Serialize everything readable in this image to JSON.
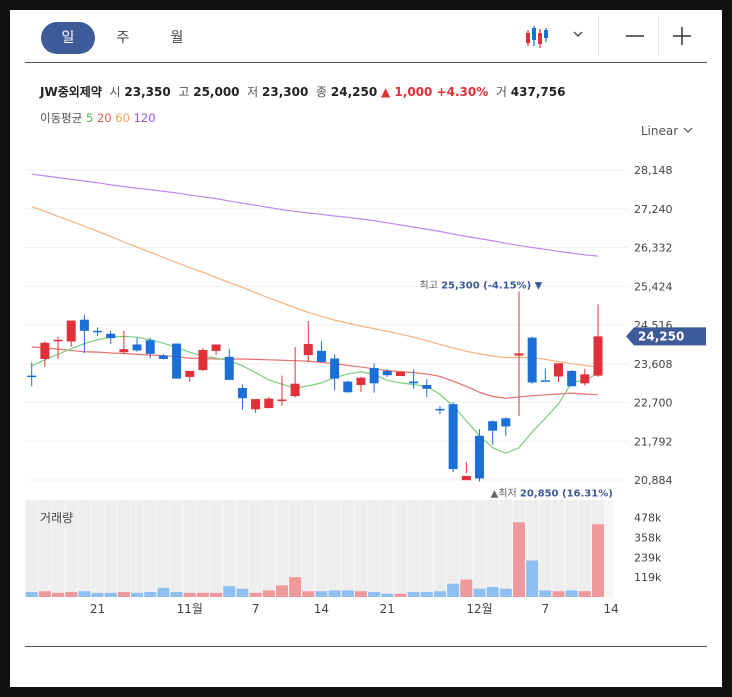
{
  "tabs": [
    {
      "label": "일",
      "active": true
    },
    {
      "label": "주",
      "active": false
    },
    {
      "label": "월",
      "active": false
    }
  ],
  "stock": {
    "name": "JW중외제약",
    "open_label": "시",
    "open": "23,350",
    "high_label": "고",
    "high": "25,000",
    "low_label": "저",
    "low": "23,300",
    "close_label": "종",
    "close": "24,250",
    "change": "▲ 1,000 +4.30%",
    "volume_label": "거",
    "volume": "437,756"
  },
  "moving_average": {
    "label": "이동평균",
    "periods": [
      {
        "value": "5",
        "color": "#4db04d"
      },
      {
        "value": "20",
        "color": "#e05a4f"
      },
      {
        "value": "60",
        "color": "#f0a05a"
      },
      {
        "value": "120",
        "color": "#9a55e0"
      }
    ]
  },
  "scale_label": "Linear",
  "volume_title": "거래량",
  "colors": {
    "up": "#e0313a",
    "down": "#1b6fd6",
    "vol_up": "#f0999c",
    "vol_down": "#8fbff0",
    "ma5": "#7ccf7c",
    "ma20": "#e8736c",
    "ma60": "#f5b27a",
    "ma120": "#bb88ee",
    "current_tag": "#3d5a99"
  },
  "chart_data": {
    "type": "candlestick",
    "y_ticks": [
      "28,148",
      "27,240",
      "26,332",
      "25,424",
      "24,516",
      "23,608",
      "22,700",
      "21,792",
      "20,884"
    ],
    "y_tick_values": [
      28148,
      27240,
      26332,
      25424,
      24516,
      23608,
      22700,
      21792,
      20884
    ],
    "volume_ticks": [
      "478k",
      "358k",
      "239k",
      "119k"
    ],
    "volume_tick_values": [
      478,
      358,
      239,
      119
    ],
    "x_labels": [
      {
        "index": 5,
        "label": "21"
      },
      {
        "index": 12,
        "label": "11월"
      },
      {
        "index": 17,
        "label": "7"
      },
      {
        "index": 22,
        "label": "14"
      },
      {
        "index": 27,
        "label": "21"
      },
      {
        "index": 34,
        "label": "12월"
      },
      {
        "index": 39,
        "label": "7"
      },
      {
        "index": 44,
        "label": "14"
      }
    ],
    "current_price": {
      "label": "24,250",
      "value": 24250
    },
    "max_annotation": {
      "label": "최고",
      "value": "25,300 (-4.15%)",
      "price": 25300,
      "index": 39
    },
    "min_annotation": {
      "label": "최저",
      "value": "20,850 (16.31%)",
      "price": 20850,
      "index": 35
    },
    "candles": [
      [
        23330,
        23640,
        23080,
        23320,
        30
      ],
      [
        23720,
        24130,
        23540,
        24100,
        35
      ],
      [
        24170,
        24240,
        23720,
        24170,
        25
      ],
      [
        24130,
        24590,
        24010,
        24620,
        30
      ],
      [
        24640,
        24760,
        23860,
        24380,
        35
      ],
      [
        24380,
        24460,
        24260,
        24360,
        25
      ],
      [
        24310,
        24380,
        24070,
        24210,
        25
      ],
      [
        23880,
        24380,
        23830,
        23950,
        30
      ],
      [
        24060,
        24220,
        23890,
        23920,
        25
      ],
      [
        24160,
        24220,
        23730,
        23840,
        30
      ],
      [
        23800,
        23840,
        23710,
        23720,
        55
      ],
      [
        24080,
        24080,
        23360,
        23260,
        30
      ],
      [
        23300,
        23410,
        23190,
        23440,
        25
      ],
      [
        23460,
        23980,
        23440,
        23930,
        25
      ],
      [
        23910,
        24060,
        23810,
        24060,
        25
      ],
      [
        23770,
        23960,
        23560,
        23230,
        65
      ],
      [
        23040,
        23120,
        22530,
        22800,
        50
      ],
      [
        22540,
        22770,
        22460,
        22780,
        25
      ],
      [
        22570,
        22830,
        22560,
        22790,
        40
      ],
      [
        22740,
        23330,
        22620,
        22770,
        70
      ],
      [
        22850,
        24000,
        22820,
        23140,
        120
      ],
      [
        23810,
        24610,
        23650,
        24070,
        35
      ],
      [
        23910,
        24140,
        23790,
        23650,
        35
      ],
      [
        23730,
        23830,
        22980,
        23260,
        40
      ],
      [
        23190,
        23210,
        22930,
        22940,
        40
      ],
      [
        23110,
        23300,
        22950,
        23280,
        35
      ],
      [
        23510,
        23620,
        22930,
        23150,
        30
      ],
      [
        23440,
        23480,
        23300,
        23340,
        20
      ],
      [
        23320,
        23430,
        23350,
        23420,
        20
      ],
      [
        23190,
        23470,
        23020,
        23150,
        30
      ],
      [
        23110,
        23250,
        22820,
        23020,
        30
      ],
      [
        22550,
        22620,
        22420,
        22530,
        35
      ],
      [
        22660,
        22710,
        21070,
        21140,
        80
      ],
      [
        20880,
        21310,
        21040,
        20980,
        105
      ],
      [
        21920,
        22070,
        20850,
        20920,
        50
      ],
      [
        22260,
        22280,
        21710,
        22040,
        60
      ],
      [
        22330,
        22350,
        21910,
        22140,
        50
      ],
      [
        23800,
        25300,
        22380,
        23850,
        450
      ],
      [
        24220,
        24240,
        23140,
        23170,
        220
      ],
      [
        23220,
        23500,
        23230,
        23200,
        40
      ],
      [
        23310,
        23390,
        23180,
        23620,
        35
      ],
      [
        23440,
        23460,
        23110,
        23080,
        40
      ],
      [
        23150,
        23490,
        23100,
        23360,
        35
      ],
      [
        23330,
        25000,
        23300,
        24250,
        438
      ]
    ],
    "ma5": [
      23560,
      23700,
      23830,
      23960,
      24080,
      24170,
      24230,
      24250,
      24230,
      24170,
      24090,
      23990,
      23880,
      23790,
      23740,
      23680,
      23560,
      23400,
      23230,
      23130,
      23040,
      23090,
      23160,
      23280,
      23370,
      23420,
      23360,
      23220,
      23160,
      23120,
      23080,
      22890,
      22620,
      22270,
      21920,
      21640,
      21510,
      21640,
      22010,
      22330,
      22670,
      23170,
      23230,
      23380
    ],
    "ma20": [
      24000,
      23980,
      23950,
      23920,
      23890,
      23880,
      23860,
      23850,
      23830,
      23810,
      23800,
      23770,
      23740,
      23730,
      23720,
      23720,
      23720,
      23710,
      23700,
      23690,
      23680,
      23670,
      23640,
      23610,
      23570,
      23530,
      23490,
      23450,
      23420,
      23400,
      23370,
      23310,
      23200,
      23080,
      22940,
      22840,
      22800,
      22830,
      22860,
      22880,
      22900,
      22920,
      22900,
      22880
    ],
    "ma60": [
      27290,
      27180,
      27060,
      26950,
      26830,
      26710,
      26590,
      26460,
      26340,
      26220,
      26100,
      25980,
      25860,
      25750,
      25630,
      25510,
      25400,
      25270,
      25150,
      25040,
      24920,
      24810,
      24720,
      24630,
      24560,
      24490,
      24430,
      24370,
      24300,
      24230,
      24150,
      24060,
      23980,
      23900,
      23840,
      23790,
      23750,
      23760,
      23750,
      23710,
      23660,
      23610,
      23570,
      23530
    ],
    "ma120": [
      28050,
      28010,
      27970,
      27930,
      27890,
      27850,
      27800,
      27760,
      27720,
      27690,
      27650,
      27610,
      27560,
      27520,
      27480,
      27420,
      27370,
      27320,
      27270,
      27220,
      27180,
      27140,
      27110,
      27070,
      27040,
      27000,
      26960,
      26910,
      26860,
      26810,
      26760,
      26710,
      26650,
      26590,
      26540,
      26490,
      26430,
      26380,
      26330,
      26290,
      26240,
      26200,
      26160,
      26130
    ]
  }
}
